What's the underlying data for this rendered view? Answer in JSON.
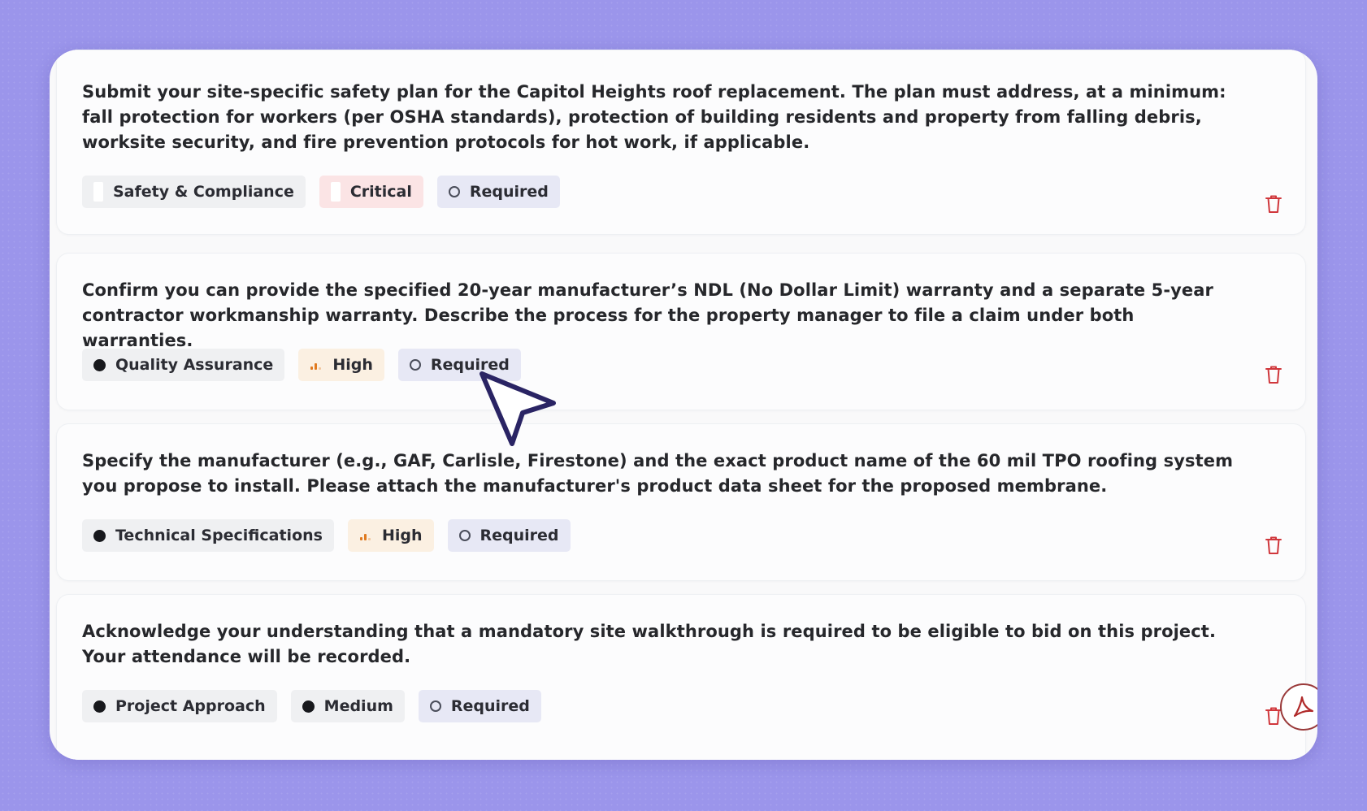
{
  "questions": [
    {
      "text": "Submit your site-specific safety plan for the Capitol Heights roof replacement. The plan must address, at a minimum: fall protection for workers (per OSHA standards), protection of building residents and property from falling debris, worksite security, and fire prevention protocols for hot work, if applicable.",
      "category": "Safety & Compliance",
      "priority": "Critical",
      "requirement": "Required"
    },
    {
      "text": "Confirm you can provide the specified 20-year manufacturer’s NDL (No Dollar Limit) warranty and a separate 5-year contractor workmanship warranty. Describe the process for the property manager to file a claim under both warranties.",
      "category": "Quality Assurance",
      "priority": "High",
      "requirement": "Required"
    },
    {
      "text": "Specify the manufacturer (e.g., GAF, Carlisle, Firestone) and the exact product name of the 60 mil TPO roofing system you propose to install. Please attach the manufacturer's product data sheet for the proposed membrane.",
      "category": "Technical Specifications",
      "priority": "High",
      "requirement": "Required"
    },
    {
      "text": "Acknowledge your understanding that a mandatory site walkthrough is required to be eligible to bid on this project. Your attendance will be recorded.",
      "category": "Project Approach",
      "priority": "Medium",
      "requirement": "Required"
    }
  ],
  "icons": {
    "delete": "trash-icon",
    "pointer": "cursor-arrow-icon",
    "pdf": "adobe-pdf-icon"
  },
  "colors": {
    "background": "#9b95eb",
    "critical_tag": "#fbe4e5",
    "high_tag": "#fbf0e2",
    "required_tag": "#e7e8f5",
    "trash": "#d0373c",
    "cursor_outline": "#2a2464"
  }
}
